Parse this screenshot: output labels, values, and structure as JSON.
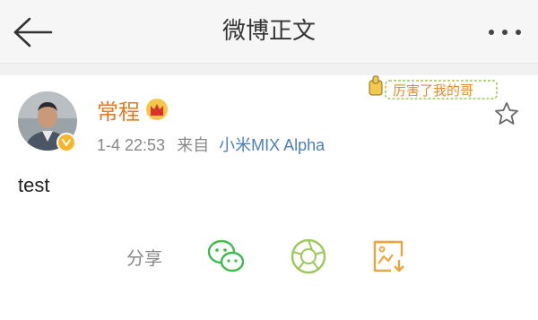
{
  "header": {
    "title": "微博正文"
  },
  "post": {
    "author": "常程",
    "timestamp": "1-4 22:53",
    "source_prefix": "来自",
    "source_app": "小米MIX Alpha",
    "body": "test",
    "sticker_text": "厉害了我的哥"
  },
  "share": {
    "label": "分享"
  },
  "colors": {
    "username": "#e17b1d",
    "source_link": "#4c7fb8",
    "wechat_green": "#3dbb4a",
    "moments_green": "#9cc85a",
    "save_orange": "#e9a43a"
  }
}
